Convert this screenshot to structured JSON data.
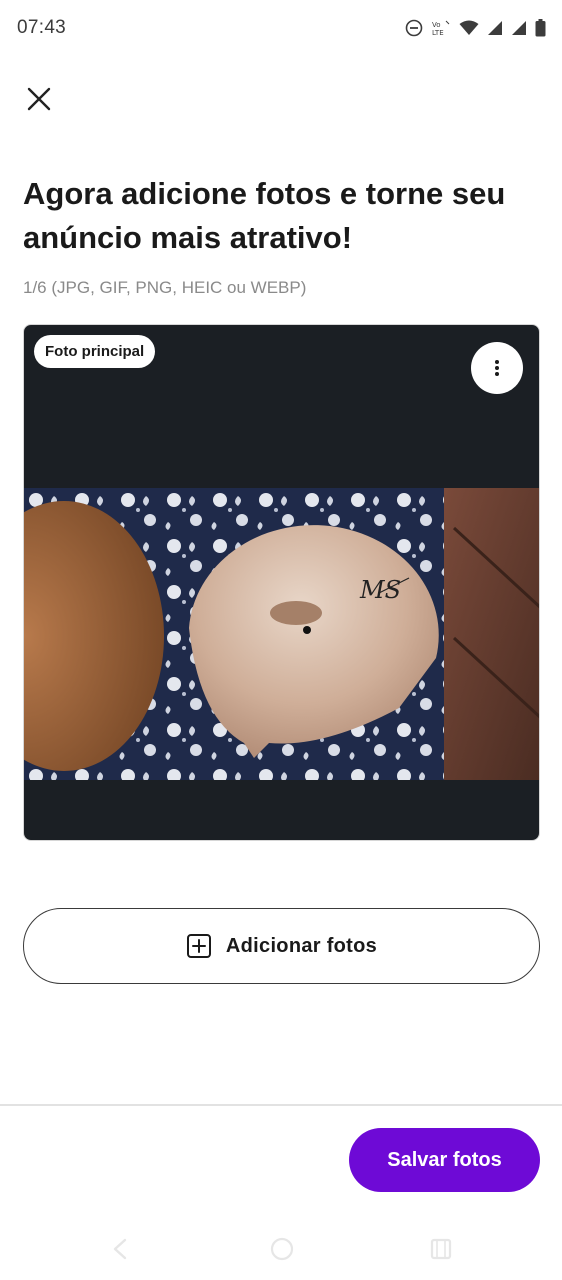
{
  "status_bar": {
    "time": "07:43",
    "icons": [
      "do-not-disturb-icon",
      "volte-icon",
      "wifi-icon",
      "signal-icon",
      "signal-icon",
      "battery-icon"
    ],
    "volte_text": "Vo LTE"
  },
  "header": {
    "close_icon": "close-icon"
  },
  "content": {
    "title": "Agora adicione fotos e torne seu anúncio mais atrativo!",
    "subtitle": "1/6 (JPG, GIF, PNG, HEIC ou WEBP)"
  },
  "photo_card": {
    "badge_label": "Foto principal",
    "menu_icon": "more-vertical-icon",
    "photo_description_icon": "cymbal-photo",
    "signature_text": "MS"
  },
  "actions": {
    "add_photos_label": "Adicionar fotos",
    "add_icon": "plus-square-icon",
    "save_label": "Salvar fotos"
  },
  "colors": {
    "accent": "#6e0ad6",
    "card_background": "#1b1f24",
    "subtitle": "#8a8a8a"
  },
  "nav_bar": {
    "buttons": [
      "back-icon",
      "home-icon",
      "recents-icon"
    ]
  }
}
